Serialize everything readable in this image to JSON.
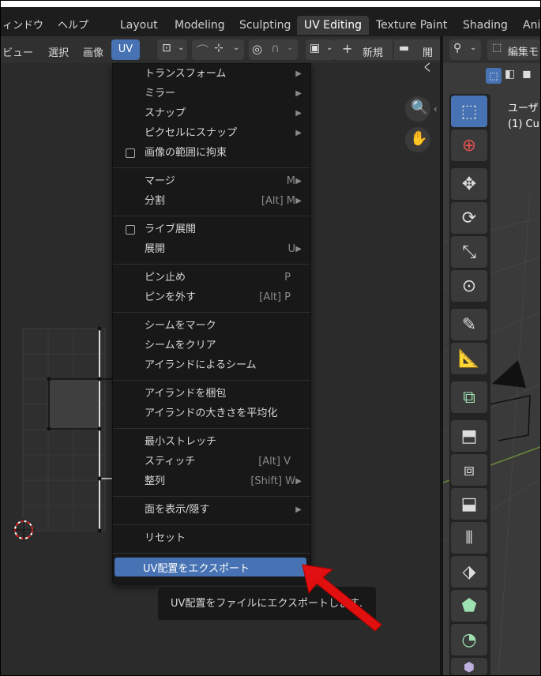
{
  "menubar": {
    "items": [
      "ィンドウ",
      "ヘルプ"
    ],
    "workspaces": [
      "Layout",
      "Modeling",
      "Sculpting",
      "UV Editing",
      "Texture Paint",
      "Shading",
      "Ani"
    ],
    "active_workspace": "UV Editing"
  },
  "uv_header": {
    "view": "ビュー",
    "select": "選択",
    "image": "画像",
    "uv": "UV",
    "new": "新規",
    "open": "開く"
  },
  "viewport_header": {
    "mode": "編集モ"
  },
  "viewport_overlay": {
    "view_name": "ユーザ",
    "object_name": "(1) Cu"
  },
  "uv_menu": {
    "items": [
      {
        "label": "トランスフォーム",
        "submenu": true
      },
      {
        "label": "ミラー",
        "submenu": true
      },
      {
        "label": "スナップ",
        "submenu": true
      },
      {
        "label": "ピクセルにスナップ",
        "submenu": true
      },
      {
        "label": "画像の範囲に拘束",
        "checkbox": true
      },
      {
        "label": "マージ",
        "shortcut": "M"
      },
      {
        "label": "分割",
        "shortcut": "[Alt] M"
      },
      {
        "label": "ライブ展開",
        "checkbox": true
      },
      {
        "label": "展開",
        "shortcut": "U"
      },
      {
        "label": "ピン止め",
        "shortcut": "P"
      },
      {
        "label": "ピンを外す",
        "shortcut": "[Alt] P"
      },
      {
        "label": "シームをマーク"
      },
      {
        "label": "シームをクリア"
      },
      {
        "label": "アイランドによるシーム"
      },
      {
        "label": "アイランドを梱包"
      },
      {
        "label": "アイランドの大きさを平均化"
      },
      {
        "label": "最小ストレッチ"
      },
      {
        "label": "スティッチ",
        "shortcut": "[Alt] V"
      },
      {
        "label": "整列",
        "shortcut": "[Shift] W"
      },
      {
        "label": "面を表示/隠す",
        "submenu": true
      },
      {
        "label": "リセット"
      },
      {
        "label": "UV配置をエクスポート"
      }
    ]
  },
  "tooltip": "UV配置をファイルにエクスポートします.",
  "colors": {
    "accent": "#4772b3",
    "annotation_arrow": "#e01010"
  }
}
